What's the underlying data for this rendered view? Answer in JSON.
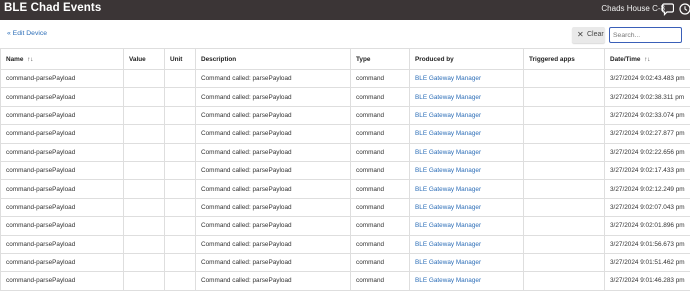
{
  "header": {
    "title": "BLE Chad Events",
    "hub_name": "Chads House C-8"
  },
  "edit_device_link": "« Edit Device",
  "toolbar": {
    "clear_label": "Clear",
    "clear_icon": "close-icon",
    "search_placeholder": "Search..."
  },
  "table": {
    "columns": [
      "Name",
      "Value",
      "Unit",
      "Description",
      "Type",
      "Produced by",
      "Triggered apps",
      "Date/Time"
    ],
    "sort_indicator": "↑↓",
    "rows": [
      {
        "name": "command-parsePayload",
        "value": "",
        "unit": "",
        "description": "Command called: parsePayload",
        "type": "command",
        "produced_by": "BLE Gateway Manager",
        "triggered_apps": "",
        "datetime": "3/27/2024 9:02:43.483 pm"
      },
      {
        "name": "command-parsePayload",
        "value": "",
        "unit": "",
        "description": "Command called: parsePayload",
        "type": "command",
        "produced_by": "BLE Gateway Manager",
        "triggered_apps": "",
        "datetime": "3/27/2024 9:02:38.311 pm"
      },
      {
        "name": "command-parsePayload",
        "value": "",
        "unit": "",
        "description": "Command called: parsePayload",
        "type": "command",
        "produced_by": "BLE Gateway Manager",
        "triggered_apps": "",
        "datetime": "3/27/2024 9:02:33.074 pm"
      },
      {
        "name": "command-parsePayload",
        "value": "",
        "unit": "",
        "description": "Command called: parsePayload",
        "type": "command",
        "produced_by": "BLE Gateway Manager",
        "triggered_apps": "",
        "datetime": "3/27/2024 9:02:27.877 pm"
      },
      {
        "name": "command-parsePayload",
        "value": "",
        "unit": "",
        "description": "Command called: parsePayload",
        "type": "command",
        "produced_by": "BLE Gateway Manager",
        "triggered_apps": "",
        "datetime": "3/27/2024 9:02:22.656 pm"
      },
      {
        "name": "command-parsePayload",
        "value": "",
        "unit": "",
        "description": "Command called: parsePayload",
        "type": "command",
        "produced_by": "BLE Gateway Manager",
        "triggered_apps": "",
        "datetime": "3/27/2024 9:02:17.433 pm"
      },
      {
        "name": "command-parsePayload",
        "value": "",
        "unit": "",
        "description": "Command called: parsePayload",
        "type": "command",
        "produced_by": "BLE Gateway Manager",
        "triggered_apps": "",
        "datetime": "3/27/2024 9:02:12.249 pm"
      },
      {
        "name": "command-parsePayload",
        "value": "",
        "unit": "",
        "description": "Command called: parsePayload",
        "type": "command",
        "produced_by": "BLE Gateway Manager",
        "triggered_apps": "",
        "datetime": "3/27/2024 9:02:07.043 pm"
      },
      {
        "name": "command-parsePayload",
        "value": "",
        "unit": "",
        "description": "Command called: parsePayload",
        "type": "command",
        "produced_by": "BLE Gateway Manager",
        "triggered_apps": "",
        "datetime": "3/27/2024 9:02:01.896 pm"
      },
      {
        "name": "command-parsePayload",
        "value": "",
        "unit": "",
        "description": "Command called: parsePayload",
        "type": "command",
        "produced_by": "BLE Gateway Manager",
        "triggered_apps": "",
        "datetime": "3/27/2024 9:01:56.673 pm"
      },
      {
        "name": "command-parsePayload",
        "value": "",
        "unit": "",
        "description": "Command called: parsePayload",
        "type": "command",
        "produced_by": "BLE Gateway Manager",
        "triggered_apps": "",
        "datetime": "3/27/2024 9:01:51.462 pm"
      },
      {
        "name": "command-parsePayload",
        "value": "",
        "unit": "",
        "description": "Command called: parsePayload",
        "type": "command",
        "produced_by": "BLE Gateway Manager",
        "triggered_apps": "",
        "datetime": "3/27/2024 9:01:46.283 pm"
      }
    ]
  }
}
